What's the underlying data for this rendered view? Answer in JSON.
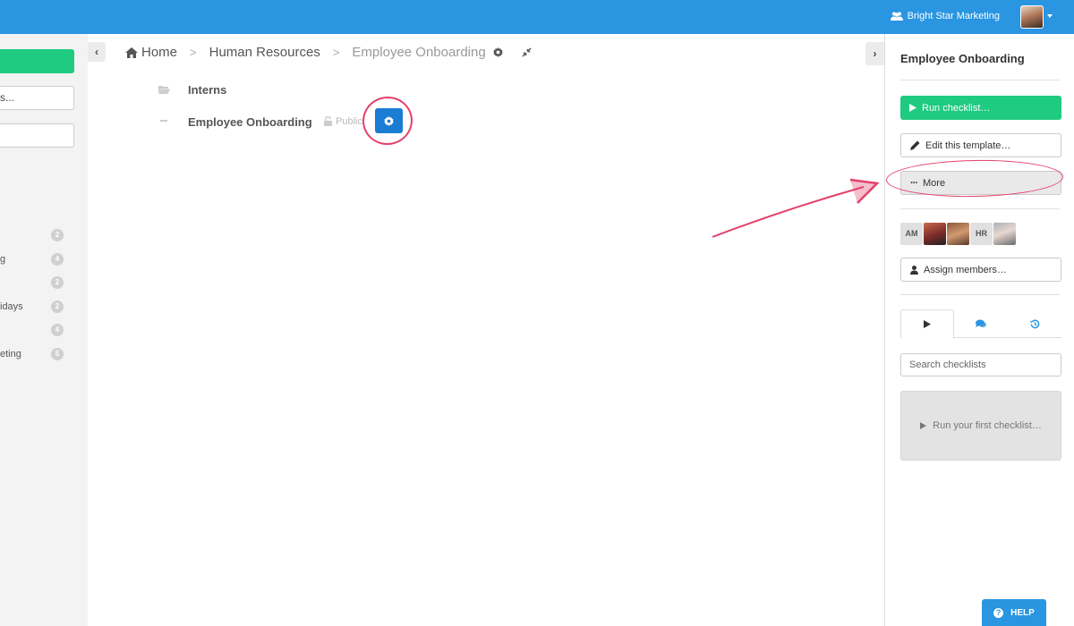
{
  "topbar": {
    "org_name": "Bright Star Marketing",
    "accent_color": "#2a95e0"
  },
  "left_sidebar": {
    "search_text": "s...",
    "items": [
      {
        "label": "",
        "count": "2"
      },
      {
        "label": "g",
        "count": "4"
      },
      {
        "label": "",
        "count": "2"
      },
      {
        "label": "idays",
        "count": "2"
      },
      {
        "label": "",
        "count": "4"
      },
      {
        "label": "eting",
        "count": "5"
      }
    ]
  },
  "breadcrumb": {
    "home": "Home",
    "level1": "Human Resources",
    "current": "Employee Onboarding"
  },
  "tree": {
    "folder_label": "Interns",
    "template_label": "Employee Onboarding",
    "visibility": "Public"
  },
  "right_panel": {
    "title": "Employee Onboarding",
    "run_checklist": "Run checklist…",
    "edit_template": "Edit this template…",
    "more": "More",
    "members": [
      "AM",
      "",
      "",
      "HR",
      ""
    ],
    "assign_members": "Assign members…",
    "search_placeholder": "Search checklists",
    "empty_state": "Run your first checklist…",
    "run_color": "#1fca81"
  },
  "help": {
    "label": "HELP"
  }
}
